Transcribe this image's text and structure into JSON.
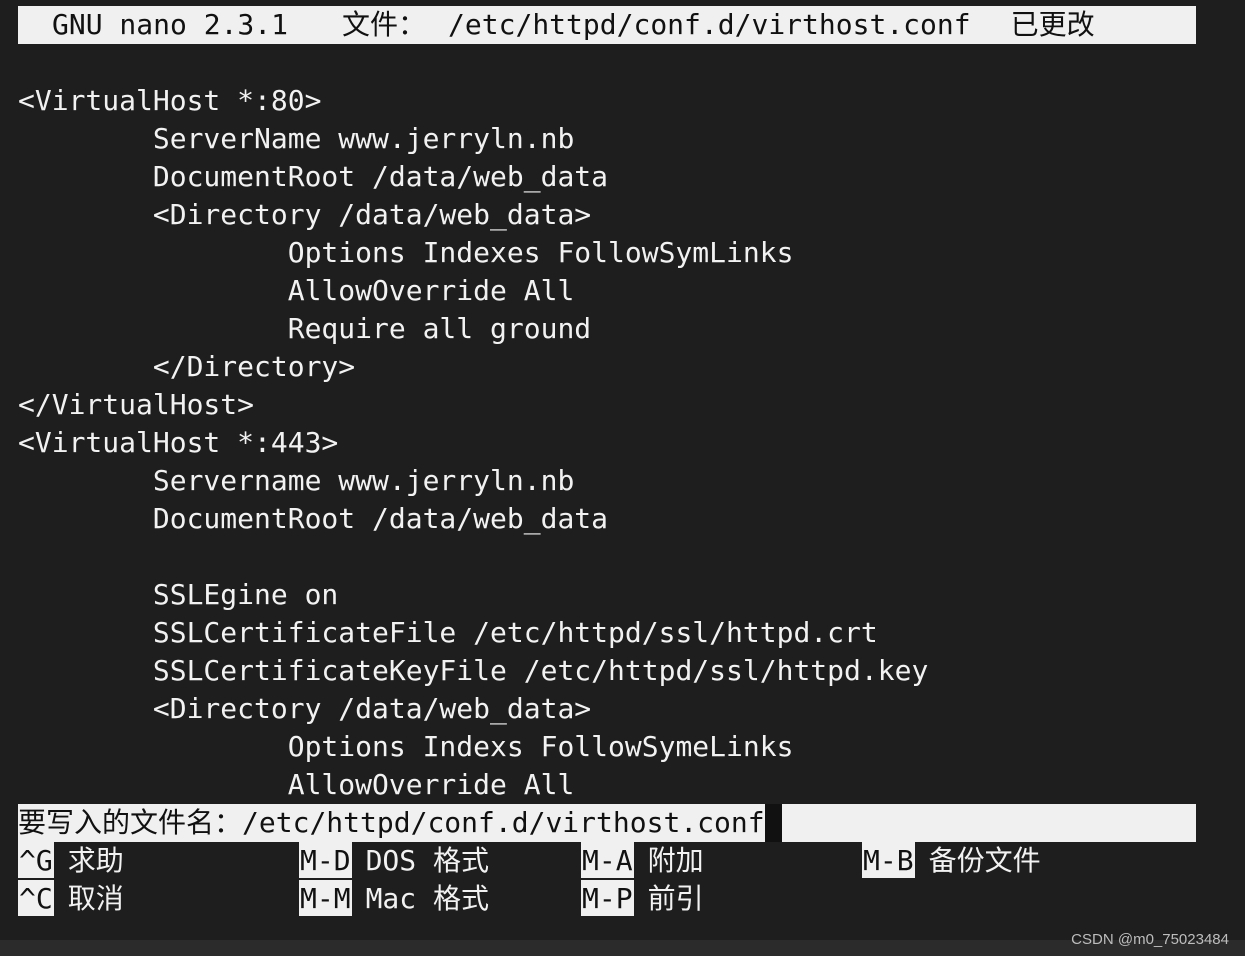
{
  "titlebar": {
    "app": "GNU nano 2.3.1",
    "file_label": "文件：",
    "file_path": "/etc/httpd/conf.d/virthost.conf",
    "status": "已更改"
  },
  "editor": {
    "lines": [
      "<VirtualHost *:80>",
      "        ServerName www.jerryln.nb",
      "        DocumentRoot /data/web_data",
      "        <Directory /data/web_data>",
      "                Options Indexes FollowSymLinks",
      "                AllowOverride All",
      "                Require all ground",
      "        </Directory>",
      "</VirtualHost>",
      "<VirtualHost *:443>",
      "        Servername www.jerryln.nb",
      "        DocumentRoot /data/web_data",
      "",
      "        SSLEgine on",
      "        SSLCertificateFile /etc/httpd/ssl/httpd.crt",
      "        SSLCertificateKeyFile /etc/httpd/ssl/httpd.key",
      "        <Directory /data/web_data>",
      "                Options Indexs FollowSymeLinks",
      "                AllowOverride All"
    ]
  },
  "prompt": {
    "label": "要写入的文件名：",
    "value": "/etc/httpd/conf.d/virthost.conf"
  },
  "shortcuts": [
    {
      "key": "^G",
      "label": "求助"
    },
    {
      "key": "M-D",
      "label": "DOS 格式"
    },
    {
      "key": "M-A",
      "label": "附加"
    },
    {
      "key": "M-B",
      "label": "备份文件"
    },
    {
      "key": "^C",
      "label": "取消"
    },
    {
      "key": "M-M",
      "label": "Mac 格式"
    },
    {
      "key": "M-P",
      "label": "前引"
    }
  ],
  "watermark": "CSDN @m0_75023484",
  "colors": {
    "background": "#1e1e1e",
    "foreground": "#f2f2f2",
    "inverse_bg": "#f0f0f0",
    "inverse_fg": "#111111"
  }
}
